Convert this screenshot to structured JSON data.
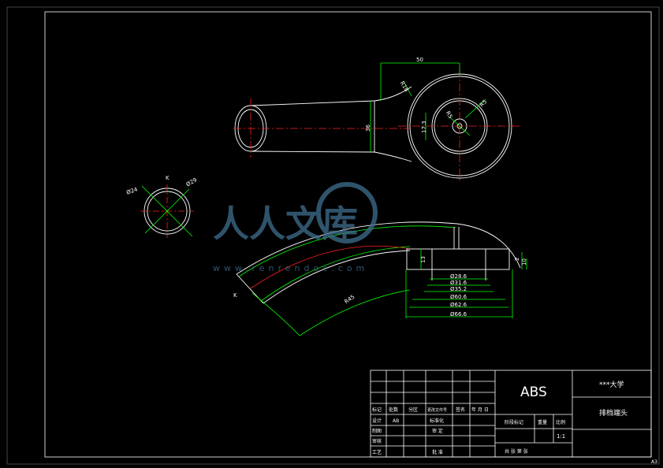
{
  "title_block": {
    "material": "ABS",
    "school": "***大学",
    "part_name": "排档端头",
    "row_mark": "标记",
    "row_count": "处数",
    "row_zone": "分区",
    "row_docno": "更改文件号",
    "row_sign": "签名",
    "row_date": "年 月 日",
    "design": "设计",
    "designer": "AB",
    "standardize": "标准化",
    "draw": "制图",
    "review": "审核",
    "check": "审 定",
    "process": "工艺",
    "approve": "批 准",
    "stage_mark": "阶段标记",
    "weight": "重量",
    "scale": "比例",
    "scale_value": "1:1",
    "sheets": "共   张 第   张",
    "sheet_size": "A3"
  },
  "dimensions": {
    "top_width": "50",
    "height_left": "36",
    "height_right": "17.3",
    "r_small": "R5",
    "r_mid": "R5",
    "r_edge": "R18",
    "dia24": "Ø24",
    "dia29": "Ø29",
    "section_label": "K",
    "section_label2": "K",
    "d1": "Ø28.6",
    "d2": "Ø31.6",
    "d3": "Ø35.2",
    "d4": "Ø60.6",
    "d5": "Ø62.6",
    "d6": "Ø66.6",
    "h13": "13",
    "h2": "2",
    "h10": "10",
    "h13b": "13",
    "r45": "R45"
  },
  "watermark": {
    "text": "人人文库",
    "url": "www.renrendoc.com"
  },
  "colors": {
    "background": "#000000",
    "green": "#00ff00",
    "white": "#ffffff",
    "red": "#ff2020",
    "watermark": "#3f6f8f"
  }
}
